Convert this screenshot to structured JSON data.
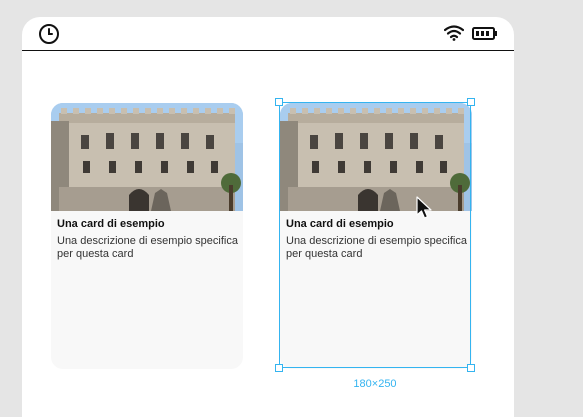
{
  "cards": [
    {
      "title": "Una card di esempio",
      "description": "Una descrizione di esempio specifica per questa card",
      "image": "building-photo"
    },
    {
      "title": "Una card di esempio",
      "description": "Una descrizione di esempio specifica per questa card",
      "image": "building-photo"
    }
  ],
  "selection": {
    "size_label": "180×250",
    "color": "#34b4f0"
  },
  "status_bar": {
    "icons": [
      "clock-icon",
      "wifi-icon",
      "battery-icon"
    ]
  }
}
